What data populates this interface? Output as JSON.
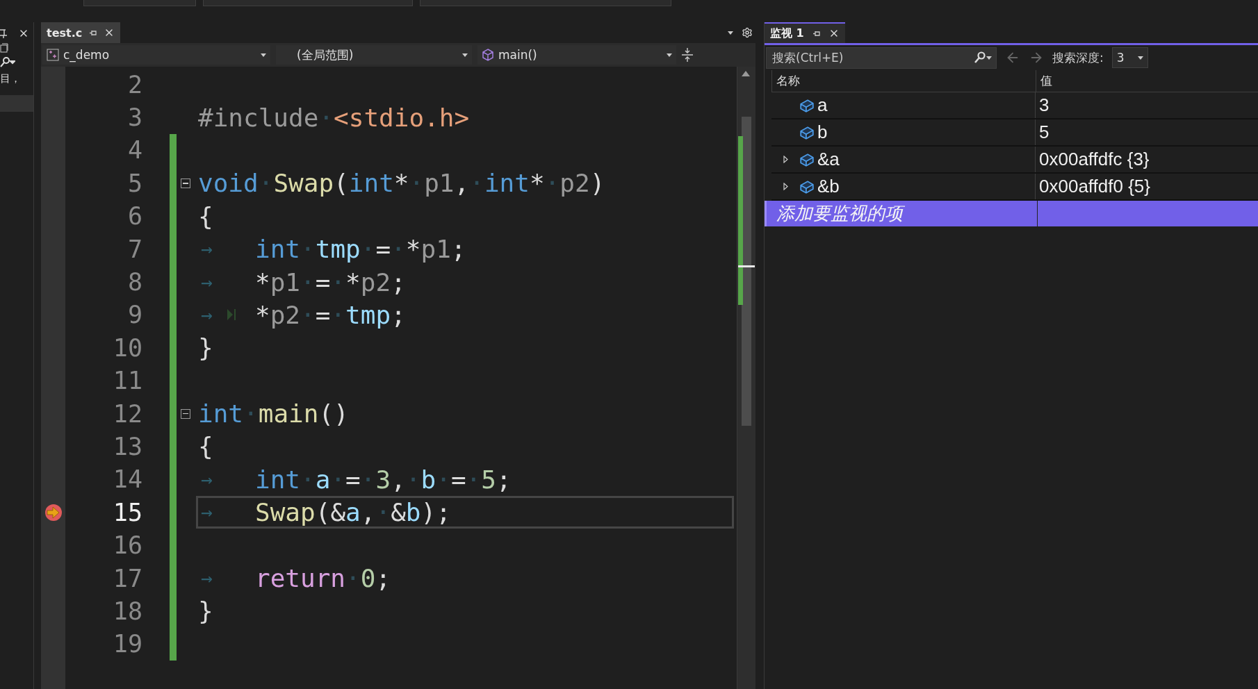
{
  "left_panel": {
    "text": "目，"
  },
  "editor": {
    "tabs": [
      {
        "label": "test.c",
        "selected": true
      }
    ],
    "nav": {
      "project": "c_demo",
      "scope": "(全局范围)",
      "member": "main()"
    },
    "lines": [
      {
        "number": "2",
        "changed": false,
        "fold_start": false,
        "current": false
      },
      {
        "number": "3",
        "changed": false,
        "fold_start": false,
        "current": false,
        "tokens": [
          {
            "t": "#include",
            "kind": "pre"
          },
          {
            "t": "·",
            "kind": "ws"
          },
          {
            "t": "<stdio.h>",
            "kind": "str"
          }
        ]
      },
      {
        "number": "4",
        "changed": true,
        "fold_start": false,
        "current": false
      },
      {
        "number": "5",
        "changed": true,
        "fold_start": true,
        "current": false,
        "tokens": [
          {
            "t": "void",
            "kind": "kw"
          },
          {
            "t": "·",
            "kind": "ws"
          },
          {
            "t": "Swap",
            "kind": "fn"
          },
          {
            "t": "(",
            "kind": "pl"
          },
          {
            "t": "int",
            "kind": "kw"
          },
          {
            "t": "*",
            "kind": "pl"
          },
          {
            "t": "·",
            "kind": "ws"
          },
          {
            "t": "p1",
            "kind": "par"
          },
          {
            "t": ",",
            "kind": "pl"
          },
          {
            "t": "·",
            "kind": "ws"
          },
          {
            "t": "int",
            "kind": "kw"
          },
          {
            "t": "*",
            "kind": "pl"
          },
          {
            "t": "·",
            "kind": "ws"
          },
          {
            "t": "p2",
            "kind": "par"
          },
          {
            "t": ")",
            "kind": "pl"
          }
        ]
      },
      {
        "number": "6",
        "changed": true,
        "fold_start": false,
        "current": false,
        "tokens": [
          {
            "t": "{",
            "kind": "pl"
          }
        ]
      },
      {
        "number": "7",
        "changed": true,
        "fold_start": false,
        "current": false,
        "tokens": [
          {
            "t": "→",
            "kind": "tab"
          },
          {
            "t": "int",
            "kind": "kw"
          },
          {
            "t": "·",
            "kind": "ws"
          },
          {
            "t": "tmp",
            "kind": "var"
          },
          {
            "t": "·",
            "kind": "ws"
          },
          {
            "t": "=",
            "kind": "pl"
          },
          {
            "t": "·",
            "kind": "ws"
          },
          {
            "t": "*",
            "kind": "pl"
          },
          {
            "t": "p1",
            "kind": "par"
          },
          {
            "t": ";",
            "kind": "pl"
          }
        ]
      },
      {
        "number": "8",
        "changed": true,
        "fold_start": false,
        "current": false,
        "tokens": [
          {
            "t": "→",
            "kind": "tab"
          },
          {
            "t": "*",
            "kind": "pl"
          },
          {
            "t": "p1",
            "kind": "par"
          },
          {
            "t": "·",
            "kind": "ws"
          },
          {
            "t": "=",
            "kind": "pl"
          },
          {
            "t": "·",
            "kind": "ws"
          },
          {
            "t": "*",
            "kind": "pl"
          },
          {
            "t": "p2",
            "kind": "par"
          },
          {
            "t": ";",
            "kind": "pl"
          }
        ]
      },
      {
        "number": "9",
        "changed": true,
        "fold_start": false,
        "current": false,
        "step_marker": true,
        "tokens": [
          {
            "t": "→",
            "kind": "tab"
          },
          {
            "t": "*",
            "kind": "pl"
          },
          {
            "t": "p2",
            "kind": "par"
          },
          {
            "t": "·",
            "kind": "ws"
          },
          {
            "t": "=",
            "kind": "pl"
          },
          {
            "t": "·",
            "kind": "ws"
          },
          {
            "t": "tmp",
            "kind": "var"
          },
          {
            "t": ";",
            "kind": "pl"
          }
        ]
      },
      {
        "number": "10",
        "changed": true,
        "fold_start": false,
        "current": false,
        "tokens": [
          {
            "t": "}",
            "kind": "pl"
          }
        ]
      },
      {
        "number": "11",
        "changed": true,
        "fold_start": false,
        "current": false
      },
      {
        "number": "12",
        "changed": true,
        "fold_start": true,
        "current": false,
        "tokens": [
          {
            "t": "int",
            "kind": "kw"
          },
          {
            "t": "·",
            "kind": "ws"
          },
          {
            "t": "main",
            "kind": "fn"
          },
          {
            "t": "()",
            "kind": "pl"
          }
        ]
      },
      {
        "number": "13",
        "changed": true,
        "fold_start": false,
        "current": false,
        "tokens": [
          {
            "t": "{",
            "kind": "pl"
          }
        ]
      },
      {
        "number": "14",
        "changed": true,
        "fold_start": false,
        "current": false,
        "tokens": [
          {
            "t": "→",
            "kind": "tab"
          },
          {
            "t": "int",
            "kind": "kw"
          },
          {
            "t": "·",
            "kind": "ws"
          },
          {
            "t": "a",
            "kind": "var"
          },
          {
            "t": "·",
            "kind": "ws"
          },
          {
            "t": "=",
            "kind": "pl"
          },
          {
            "t": "·",
            "kind": "ws"
          },
          {
            "t": "3",
            "kind": "num"
          },
          {
            "t": ",",
            "kind": "pl"
          },
          {
            "t": "·",
            "kind": "ws"
          },
          {
            "t": "b",
            "kind": "var"
          },
          {
            "t": "·",
            "kind": "ws"
          },
          {
            "t": "=",
            "kind": "pl"
          },
          {
            "t": "·",
            "kind": "ws"
          },
          {
            "t": "5",
            "kind": "num"
          },
          {
            "t": ";",
            "kind": "pl"
          }
        ]
      },
      {
        "number": "15",
        "changed": true,
        "fold_start": false,
        "current": true,
        "tokens": [
          {
            "t": "→",
            "kind": "tab"
          },
          {
            "t": "Swap",
            "kind": "fn"
          },
          {
            "t": "(&",
            "kind": "pl"
          },
          {
            "t": "a",
            "kind": "var"
          },
          {
            "t": ",",
            "kind": "pl"
          },
          {
            "t": "·",
            "kind": "ws"
          },
          {
            "t": "&",
            "kind": "pl"
          },
          {
            "t": "b",
            "kind": "var"
          },
          {
            "t": ");",
            "kind": "pl"
          }
        ]
      },
      {
        "number": "16",
        "changed": true,
        "fold_start": false,
        "current": false
      },
      {
        "number": "17",
        "changed": true,
        "fold_start": false,
        "current": false,
        "tokens": [
          {
            "t": "→",
            "kind": "tab"
          },
          {
            "t": "return",
            "kind": "ctl"
          },
          {
            "t": "·",
            "kind": "ws"
          },
          {
            "t": "0",
            "kind": "num"
          },
          {
            "t": ";",
            "kind": "pl"
          }
        ]
      },
      {
        "number": "18",
        "changed": true,
        "fold_start": false,
        "current": false,
        "tokens": [
          {
            "t": "}",
            "kind": "pl"
          }
        ]
      },
      {
        "number": "19",
        "changed": true,
        "fold_start": false,
        "current": false
      }
    ]
  },
  "watch": {
    "tabs": [
      {
        "label": "监视 1",
        "selected": true
      }
    ],
    "search": {
      "placeholder": "搜索(Ctrl+E)"
    },
    "depth_label": "搜索深度:",
    "depth_value": "3",
    "columns": [
      "名称",
      "值"
    ],
    "rows": [
      {
        "name": "a",
        "value": "3",
        "expandable": false
      },
      {
        "name": "b",
        "value": "5",
        "expandable": false
      },
      {
        "name": "&a",
        "value": "0x00affdfc {3}",
        "expandable": true
      },
      {
        "name": "&b",
        "value": "0x00affdf0 {5}",
        "expandable": true
      }
    ],
    "add_row": {
      "text": "添加要监视的项",
      "selected": true
    }
  }
}
